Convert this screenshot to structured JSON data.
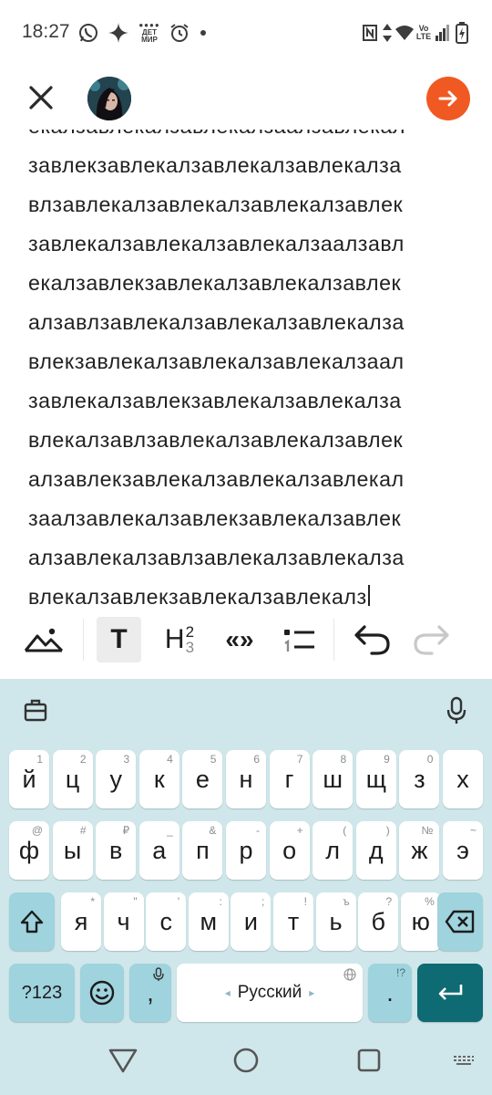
{
  "status_bar": {
    "time": "18:27",
    "left_icons": [
      "whatsapp-icon",
      "sparkle-icon",
      "detmir-app-icon",
      "alarm-icon",
      "dot-icon"
    ],
    "detmir_text": [
      "ДЕТ",
      "МИР"
    ],
    "right_icons": [
      "nfc-icon",
      "data-arrows-icon",
      "wifi-icon",
      "volte-icon",
      "signal-icon",
      "battery-charging-icon"
    ],
    "volte_text": [
      "Vo",
      "LTE"
    ]
  },
  "header": {
    "close_icon": "close-icon",
    "avatar": "avatar",
    "next_icon": "arrow-right-icon",
    "accent_color": "#f05a22"
  },
  "editor": {
    "lines": [
      "екалзавлекалзавлекалзаалзавлекал",
      "завлекзавлекалзавлекалзавлекалза",
      "влзавлекалзавлекалзавлекалзавлек",
      "завлекалзавлекалзавлекалзаалзавл",
      "екалзавлекзавлекалзавлекалзавлек",
      "алзавлзавлекалзавлекалзавлекалза",
      "влекзавлекалзавлекалзавлекалзаал",
      "завлекалзавлекзавлекалзавлекалза",
      "влекалзавлзавлекалзавлекалзавлек",
      "алзавлекзавлекалзавлекалзавлекал",
      "заалзавлекалзавлекзавлекалзавлек",
      "алзавлекалзавлзавлекалзавлекалза",
      "влекалзавлекзавлекалзавлекалз"
    ]
  },
  "toolbar": {
    "image_icon": "image-icon",
    "text_label": "T",
    "heading_label": "H",
    "heading_sup": "2",
    "heading_sub": "3",
    "quote_label": "«»",
    "list_icon": "list-icon",
    "undo_icon": "undo-icon",
    "redo_icon": "redo-icon"
  },
  "keyboard": {
    "top_icons": [
      "clipboard-icon",
      "microphone-icon"
    ],
    "row1": [
      {
        "label": "й",
        "hint": "1"
      },
      {
        "label": "ц",
        "hint": "2"
      },
      {
        "label": "у",
        "hint": "3"
      },
      {
        "label": "к",
        "hint": "4"
      },
      {
        "label": "е",
        "hint": "5"
      },
      {
        "label": "н",
        "hint": "6"
      },
      {
        "label": "г",
        "hint": "7"
      },
      {
        "label": "ш",
        "hint": "8"
      },
      {
        "label": "щ",
        "hint": "9"
      },
      {
        "label": "з",
        "hint": "0"
      },
      {
        "label": "х",
        "hint": ""
      }
    ],
    "row2": [
      {
        "label": "ф",
        "hint": "@"
      },
      {
        "label": "ы",
        "hint": "#"
      },
      {
        "label": "в",
        "hint": "₽"
      },
      {
        "label": "а",
        "hint": "_"
      },
      {
        "label": "п",
        "hint": "&"
      },
      {
        "label": "р",
        "hint": "-"
      },
      {
        "label": "о",
        "hint": "+"
      },
      {
        "label": "л",
        "hint": "("
      },
      {
        "label": "д",
        "hint": ")"
      },
      {
        "label": "ж",
        "hint": "№"
      },
      {
        "label": "э",
        "hint": "~"
      }
    ],
    "row3": [
      {
        "label": "я",
        "hint": "*"
      },
      {
        "label": "ч",
        "hint": "\""
      },
      {
        "label": "с",
        "hint": "'"
      },
      {
        "label": "м",
        "hint": ":"
      },
      {
        "label": "и",
        "hint": ";"
      },
      {
        "label": "т",
        "hint": "!"
      },
      {
        "label": "ь",
        "hint": "ъ"
      },
      {
        "label": "б",
        "hint": "?"
      },
      {
        "label": "ю",
        "hint": "%"
      }
    ],
    "shift_icon": "shift-icon",
    "backspace_icon": "backspace-icon",
    "symbols_label": "?123",
    "emoji_icon": "emoji-icon",
    "comma_label": ",",
    "space_label": "Русский",
    "space_left": "◂",
    "space_right": "▸",
    "globe_icon": "globe-icon",
    "period_label": ".",
    "period_hint": "!?",
    "enter_icon": "enter-icon",
    "colors": {
      "background": "#cfe7ea",
      "modifier": "#9fd3dd",
      "enter": "#0e6a73"
    }
  },
  "nav_bar": {
    "back_icon": "back-triangle-icon",
    "home_icon": "home-circle-icon",
    "recents_icon": "recents-square-icon",
    "keyboard_hide_icon": "keyboard-icon"
  }
}
